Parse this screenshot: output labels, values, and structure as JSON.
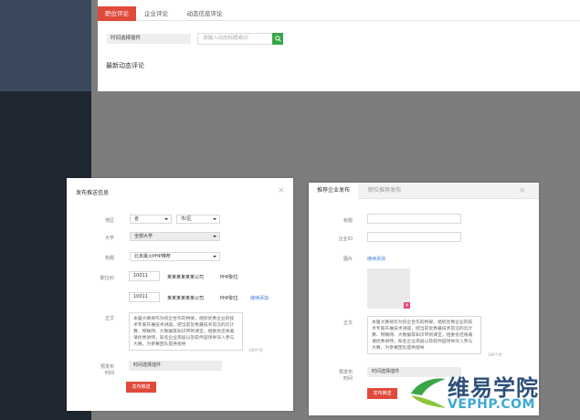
{
  "top": {
    "tabs": [
      {
        "label": "职位评论",
        "active": true
      },
      {
        "label": "企业评论",
        "active": false
      },
      {
        "label": "动态信息评论",
        "active": false
      }
    ],
    "filter_value": "时间选择插件",
    "search_placeholder": "请输入动态标题或ID",
    "section_title": "最新动态评论"
  },
  "left_dialog": {
    "title": "发布推送信息",
    "region_label": "地区",
    "province_value": "省",
    "city_value": "市/区",
    "university_label": "大学",
    "university_value": "全部大学",
    "tag_label": "标题",
    "tag_value": "北京最火PHP推荐",
    "job_label": "职位ID",
    "rows": [
      {
        "id": "10011",
        "company": "某某某某某某公司",
        "job": "PHP职位"
      },
      {
        "id": "10011",
        "company": "某某某某某某公司",
        "job": "PHP职位"
      }
    ],
    "add_link": "继续添加",
    "body_label": "正文",
    "body_text": "本届大赛将作为校企合作的桥梁，组织优秀企业的技术专家开展技术讲座，把当前优秀最技术前沿的云计算、物联网、大数据等知识带到课堂，组委会还将邀请优秀讲师，知名企业高层以及软件园领导深入参与大赛，为参赛团队提供指导",
    "counter": "140个字",
    "time_label_1": "预发布",
    "time_label_2": "时间",
    "time_value": "时间选择插件",
    "submit_label": "发布推送"
  },
  "right_dialog": {
    "tab_active": "推荐企业发布",
    "tab_inactive": "职位推荐发布",
    "title_label": "标题",
    "company_label": "企业ID",
    "image_label": "图片",
    "image_link": "继续添加",
    "image_delete": "×",
    "body_label": "正文",
    "body_text": "本届大赛将作为校企合作的桥梁，组织优秀企业的技术专家开展技术讲座，把当前优秀最技术前沿的云计算、物联网、大数据等知识带到课堂，组委会还将邀请优秀讲师，知名企业高层以及软件园领导深入参与大赛，为参赛团队提供指导",
    "counter": "140个字",
    "time_label_1": "预发布",
    "time_label_2": "时间",
    "time_value": "时间选择插件",
    "submit_label": "发布推送"
  },
  "close_glyph": "×",
  "watermark": {
    "cn": "维易学院",
    "en": "VEPHP.COM"
  }
}
